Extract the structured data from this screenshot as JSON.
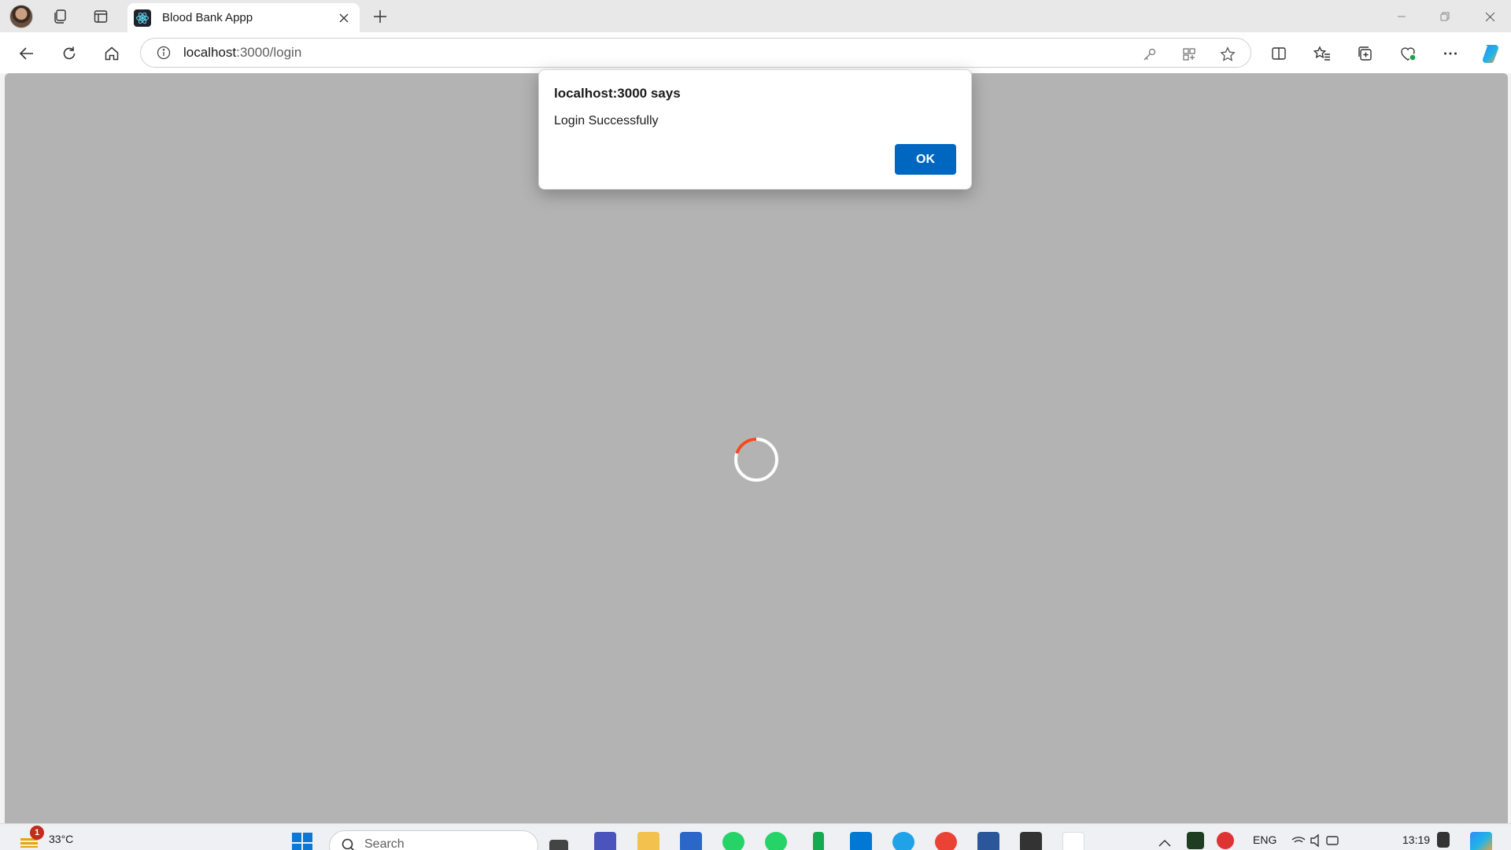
{
  "browser": {
    "tab": {
      "title": "Blood Bank Appp"
    },
    "address": {
      "host": "localhost",
      "rest": ":3000/login"
    }
  },
  "dialog": {
    "heading": "localhost:3000 says",
    "message": "Login Successfully",
    "ok_label": "OK"
  },
  "colors": {
    "accent": "#0067c0",
    "spinner": "#f24a1f",
    "overlay": "#b3b3b3"
  },
  "taskbar": {
    "weather": {
      "temp": "33°C",
      "badge": "1"
    },
    "search_placeholder": "Search",
    "language": "ENG",
    "time": "13:19"
  }
}
